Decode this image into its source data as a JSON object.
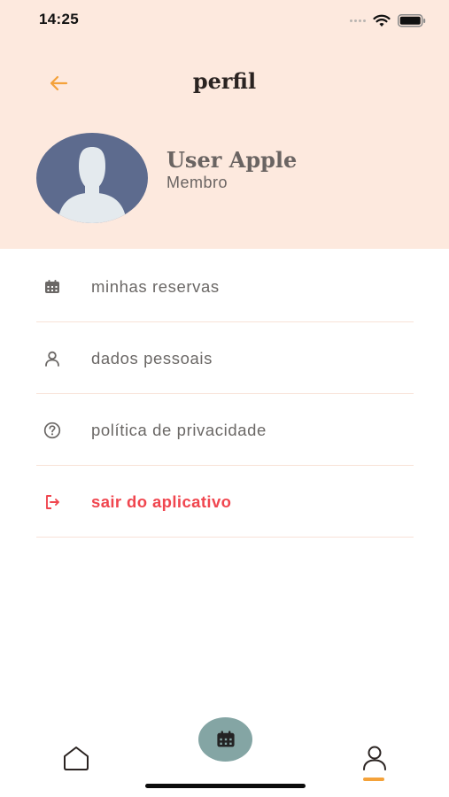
{
  "status_bar": {
    "time": "14:25"
  },
  "header": {
    "title": "perfil"
  },
  "profile": {
    "name": "User Apple",
    "role": "Membro"
  },
  "menu": [
    {
      "label": "minhas reservas",
      "icon": "calendar-icon"
    },
    {
      "label": "dados pessoais",
      "icon": "person-icon"
    },
    {
      "label": "política de privacidade",
      "icon": "help-circle-icon"
    },
    {
      "label": "sair do aplicativo",
      "icon": "logout-icon",
      "color": "#f0464f"
    }
  ],
  "bottom_nav": {
    "items": [
      {
        "icon": "home-icon"
      },
      {
        "icon": "calendar-icon"
      },
      {
        "icon": "user-icon",
        "active": true
      }
    ]
  },
  "colors": {
    "header_bg": "#fde9de",
    "accent": "#f4a23a",
    "danger": "#f0464f",
    "fab": "#84a5a4",
    "avatar_bg": "#5d6b8e"
  }
}
